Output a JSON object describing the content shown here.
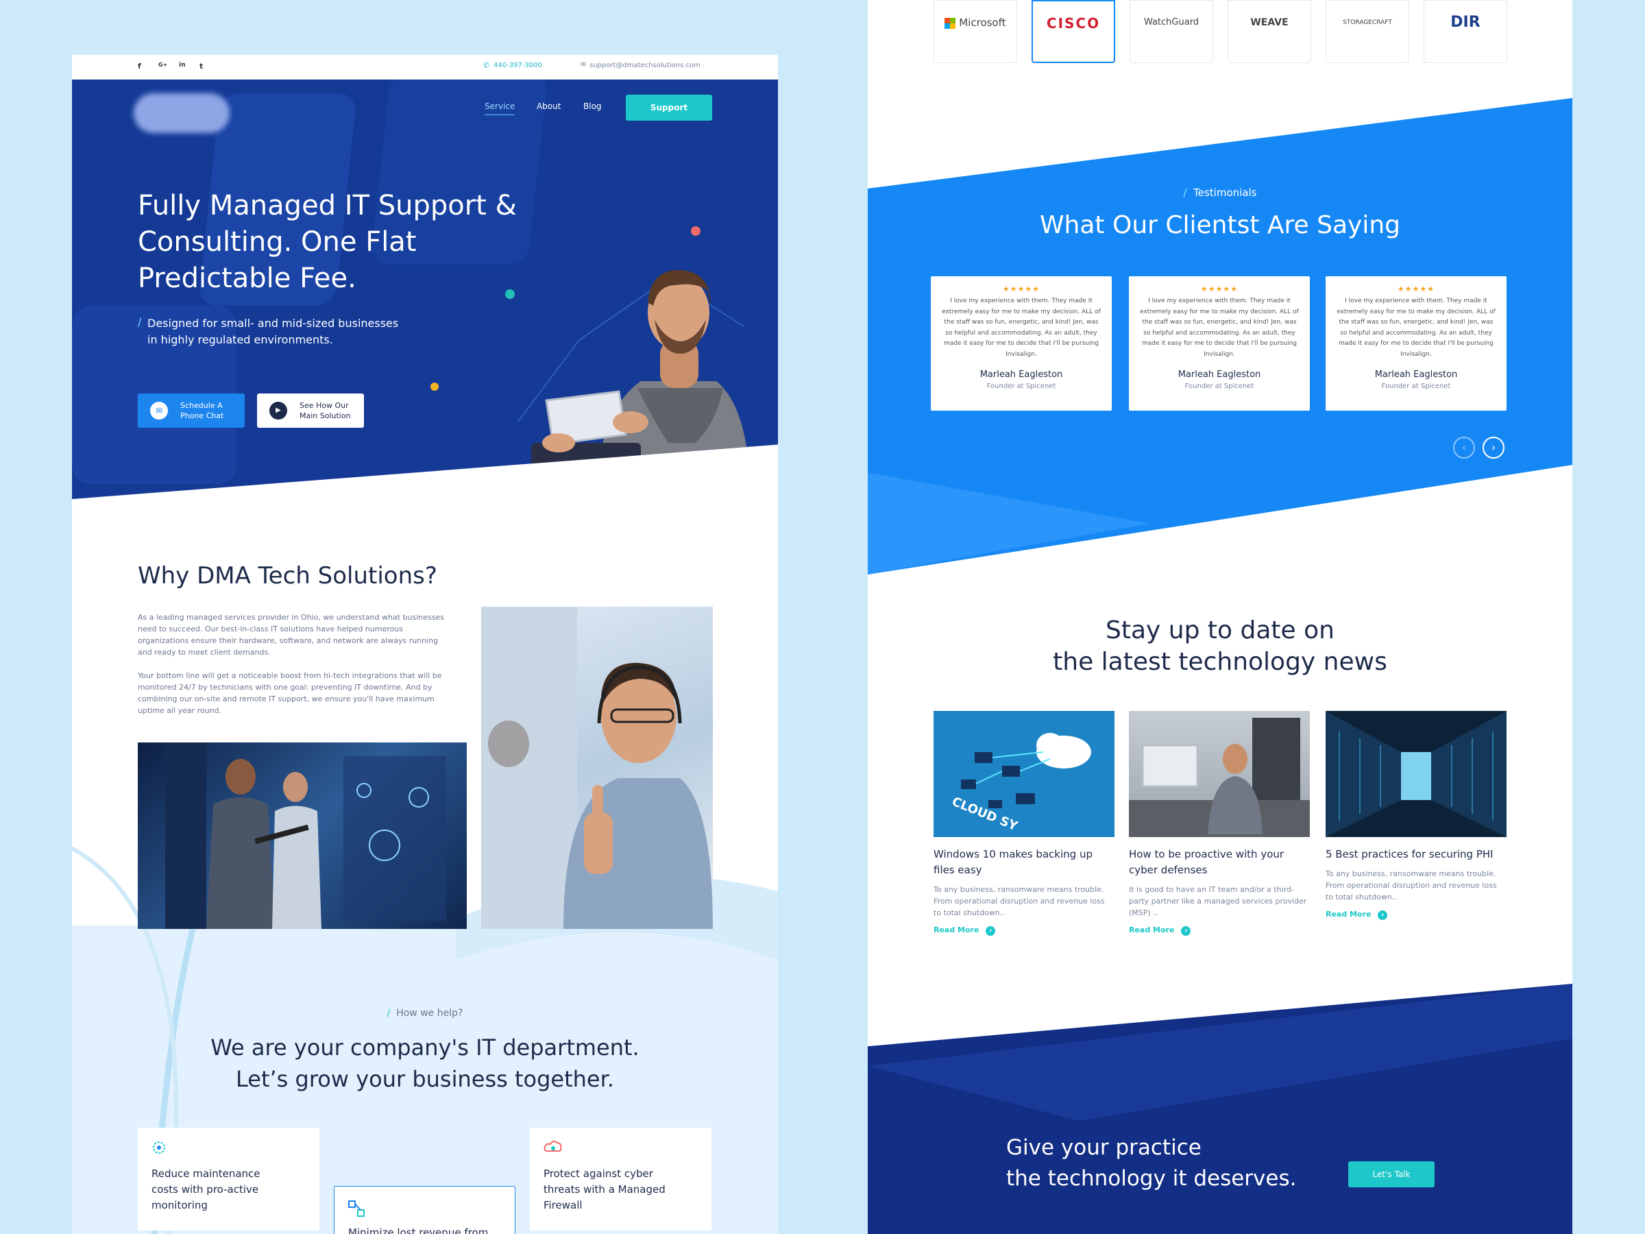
{
  "topbar": {
    "phone": "440-397-3000",
    "email": "support@dmatechsolutions.com",
    "social": [
      "f",
      "G+",
      "in",
      "t"
    ]
  },
  "nav": {
    "service": "Service",
    "about": "About",
    "blog": "Blog",
    "support": "Support"
  },
  "hero": {
    "title": "Fully Managed IT Support & Consulting. One Flat Predictable Fee.",
    "subtitle": "Designed for small- and mid-sized businesses in highly regulated environments.",
    "btn_schedule": "Schedule A Phone Chat",
    "btn_see": "See How Our Main Solution"
  },
  "why": {
    "title": "Why DMA Tech Solutions?",
    "p1": "As a leading managed services provider in Ohio, we understand what businesses need to succeed. Our best-in-class IT solutions have helped numerous organizations ensure their hardware, software, and network are always running and ready to meet client demands.",
    "p2": "Your bottom line will get a noticeable boost from hi-tech integrations that will be monitored 24/7 by technicians with one goal: preventing IT downtime. And by combining our on-site and remote IT support, we ensure you'll have maximum uptime all year round."
  },
  "help": {
    "kicker": "How we help?",
    "title1": "We are your company's IT department.",
    "title2": "Let’s grow your business together.",
    "cards": [
      "Reduce maintenance costs with pro-active monitoring",
      "Minimize lost revenue from",
      "Protect against cyber threats with a Managed Firewall"
    ]
  },
  "partners": [
    "Microsoft",
    "CISCO",
    "WatchGuard",
    "WEAVE",
    "STORAGECRAFT",
    "DIR"
  ],
  "testimonials": {
    "kicker": "Testimonials",
    "title": "What Our Clientst  Are Saying",
    "stars": "★★★★★",
    "quote": "I love my experience with them. They made it extremely easy for me to make my decision. ALL of the staff was so fun, energetic, and kind! Jen, was so helpful and accommodating. As an adult, they made it easy for me to decide that I'll be pursuing Invisalign.",
    "items": [
      {
        "name": "Marleah Eagleston",
        "role": "Founder at Spicenet"
      },
      {
        "name": "Marleah Eagleston",
        "role": "Founder at Spicenet"
      },
      {
        "name": "Marleah Eagleston",
        "role": "Founder at Spicenet"
      }
    ]
  },
  "news": {
    "title1": "Stay up to date on",
    "title2": "the latest technology news",
    "read_more": "Read More",
    "items": [
      {
        "title": "Windows 10 makes backing up files easy",
        "text": "To any business, ransomware means trouble. From operational disruption and revenue loss to total shutdown..",
        "tag": "CLOUD SY"
      },
      {
        "title": "How to be proactive with your cyber defenses",
        "text": "It is good to have an IT team and/or a third-party partner like a managed services provider (MSP) .."
      },
      {
        "title": "5 Best practices for securing PHI",
        "text": "To any business, ransomware means trouble. From operational disruption and revenue loss to total shutdown.."
      }
    ]
  },
  "cta": {
    "line1": "Give your practice",
    "line2": "the technology it deserves.",
    "button": "Let's Talk"
  },
  "colors": {
    "hero_bg": "#143a96",
    "accent": "#1ec7c9",
    "blue": "#1688f5",
    "navy": "#122e85",
    "star": "#f6a623"
  }
}
